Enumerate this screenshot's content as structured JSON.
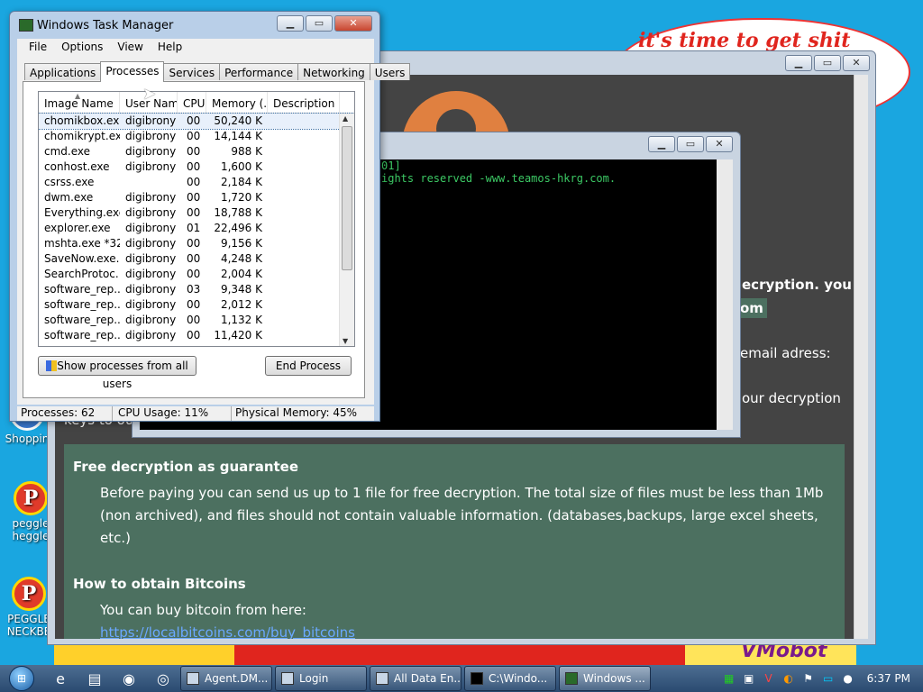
{
  "wallpaper": {
    "banner_text": "it's time to get shit",
    "brand_text": "VMobot"
  },
  "desktop_icons": [
    {
      "label": "Shoppin",
      "glyph": "S"
    },
    {
      "label": "peggle heggle",
      "glyph": "P"
    },
    {
      "label": "PEGGLE NECKBE",
      "glyph": "P"
    }
  ],
  "ransom_page": {
    "line1": "ecryption. you",
    "line2": "om",
    "line3": "email adress:",
    "line4": "our decryption",
    "line5": "keys to ou",
    "panel1": {
      "title": "Free decryption as guarantee",
      "text": "Before paying you can send us up to 1 file for free decryption. The total size of files must be less than 1Mb (non archived), and files should not contain valuable information. (databases,backups, large excel sheets, etc.)"
    },
    "panel2": {
      "title": "How to obtain Bitcoins",
      "text": "You can buy bitcoin from here:",
      "link": "https://localbitcoins.com/buy_bitcoins"
    }
  },
  "console": {
    "line1": "01]",
    "line2": "ights reserved -www.teamos-hkrg.com."
  },
  "taskmgr": {
    "title": "Windows Task Manager",
    "menu": [
      "File",
      "Options",
      "View",
      "Help"
    ],
    "tabs": [
      "Applications",
      "Processes",
      "Services",
      "Performance",
      "Networking",
      "Users"
    ],
    "columns": [
      "Image Name",
      "User Name",
      "CPU",
      "Memory (...",
      "Description"
    ],
    "processes": [
      {
        "name": "chomikbox.ex...",
        "user": "digibrony",
        "cpu": "00",
        "mem": "50,240 K"
      },
      {
        "name": "chomikrypt.exe",
        "user": "digibrony",
        "cpu": "00",
        "mem": "14,144 K"
      },
      {
        "name": "cmd.exe",
        "user": "digibrony",
        "cpu": "00",
        "mem": "988 K"
      },
      {
        "name": "conhost.exe",
        "user": "digibrony",
        "cpu": "00",
        "mem": "1,600 K"
      },
      {
        "name": "csrss.exe",
        "user": "",
        "cpu": "00",
        "mem": "2,184 K"
      },
      {
        "name": "dwm.exe",
        "user": "digibrony",
        "cpu": "00",
        "mem": "1,720 K"
      },
      {
        "name": "Everything.exe",
        "user": "digibrony",
        "cpu": "00",
        "mem": "18,788 K"
      },
      {
        "name": "explorer.exe",
        "user": "digibrony",
        "cpu": "01",
        "mem": "22,496 K"
      },
      {
        "name": "mshta.exe *32",
        "user": "digibrony",
        "cpu": "00",
        "mem": "9,156 K"
      },
      {
        "name": "SaveNow.exe...",
        "user": "digibrony",
        "cpu": "00",
        "mem": "4,248 K"
      },
      {
        "name": "SearchProtoc...",
        "user": "digibrony",
        "cpu": "00",
        "mem": "2,004 K"
      },
      {
        "name": "software_rep...",
        "user": "digibrony",
        "cpu": "03",
        "mem": "9,348 K"
      },
      {
        "name": "software_rep...",
        "user": "digibrony",
        "cpu": "00",
        "mem": "2,012 K"
      },
      {
        "name": "software_rep...",
        "user": "digibrony",
        "cpu": "00",
        "mem": "1,132 K"
      },
      {
        "name": "software_rep...",
        "user": "digibrony",
        "cpu": "00",
        "mem": "11,420 K"
      }
    ],
    "show_all_button": "Show processes from all users",
    "end_process_button": "End Process",
    "status": {
      "processes": "Processes: 62",
      "cpu": "CPU Usage: 11%",
      "memory": "Physical Memory: 45%"
    }
  },
  "taskbar": {
    "tasks": [
      {
        "label": "Agent.DM..."
      },
      {
        "label": "Login"
      },
      {
        "label": "All Data En..."
      },
      {
        "label": "C:\\Windo..."
      },
      {
        "label": "Windows ..."
      }
    ],
    "clock": "6:37 PM"
  }
}
